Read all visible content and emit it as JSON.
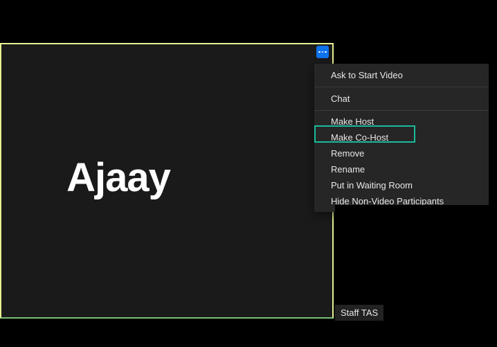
{
  "participant": {
    "name": "Ajaay"
  },
  "secondary_tile": {
    "label": "Staff TAS"
  },
  "context_menu": {
    "items": [
      {
        "label": "Ask to Start Video",
        "id": "ask-start-video"
      },
      {
        "label": "Chat",
        "id": "chat"
      },
      {
        "label": "Make Host",
        "id": "make-host"
      },
      {
        "label": "Make Co-Host",
        "id": "make-cohost",
        "highlighted": true
      },
      {
        "label": "Remove",
        "id": "remove"
      },
      {
        "label": "Rename",
        "id": "rename"
      },
      {
        "label": "Put in Waiting Room",
        "id": "put-waiting-room"
      },
      {
        "label": "Hide Non-Video Participants",
        "id": "hide-non-video"
      }
    ]
  },
  "more_button": {
    "icon": "horizontal-dots"
  }
}
